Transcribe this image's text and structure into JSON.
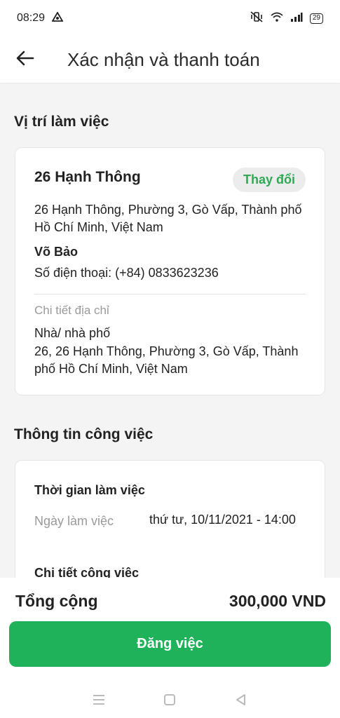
{
  "status_bar": {
    "time": "08:29",
    "battery": "29",
    "icons": [
      "app-notification-icon",
      "mute-vibrate-icon",
      "wifi-icon",
      "signal-icon",
      "battery-icon"
    ]
  },
  "header": {
    "title": "Xác nhận và thanh toán",
    "back_icon": "arrow-left-icon"
  },
  "location_section": {
    "title": "Vị trí làm việc",
    "address_name": "26 Hạnh Thông",
    "change_label": "Thay đổi",
    "address_full": "26 Hạnh Thông, Phường 3, Gò Vấp, Thành phố Hồ Chí Minh, Việt Nam",
    "contact_name": "Võ Bảo",
    "phone": "Số điện thoại: (+84) 0833623236",
    "detail_label": "Chi tiết địa chỉ",
    "house_type": "Nhà/ nhà phố",
    "detail_address": "26, 26 Hạnh Thông, Phường 3, Gò Vấp, Thành phố Hồ Chí Minh, Việt Nam"
  },
  "job_section": {
    "title": "Thông tin công việc",
    "time_title": "Thời gian làm việc",
    "date_label": "Ngày làm việc",
    "date_value": "thứ tư, 10/11/2021 - 14:00",
    "detail_title": "Chi tiết công việc"
  },
  "footer": {
    "total_label": "Tổng cộng",
    "total_value": "300,000 VND",
    "post_button": "Đăng việc"
  },
  "colors": {
    "accent_green": "#1fb25a",
    "change_text_green": "#2eaa55"
  },
  "nav_bar": {
    "icons": [
      "menu-icon",
      "home-square-icon",
      "back-triangle-icon"
    ]
  }
}
